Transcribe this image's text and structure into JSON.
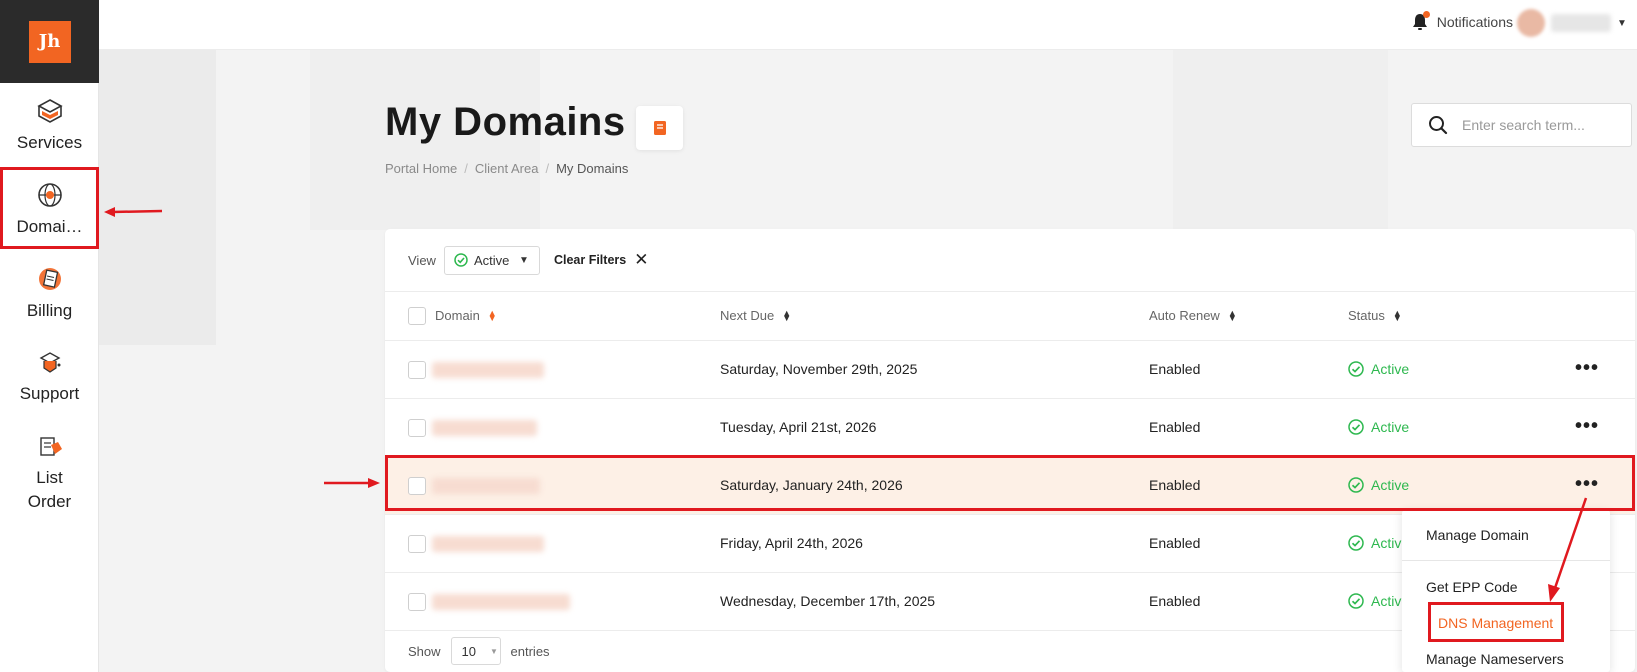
{
  "brand": {
    "logo_text": "Jh",
    "accent": "#f26522"
  },
  "sidebar": {
    "items": [
      {
        "label": "Services",
        "icon": "cube-icon"
      },
      {
        "label": "Domai…",
        "icon": "globe-icon"
      },
      {
        "label": "Billing",
        "icon": "invoice-icon"
      },
      {
        "label": "Support",
        "icon": "support-icon"
      },
      {
        "label": "List Order",
        "icon": "order-list-icon"
      }
    ]
  },
  "topbar": {
    "notifications_label": "Notifications"
  },
  "page": {
    "title": "My Domains",
    "breadcrumb": [
      "Portal Home",
      "Client Area",
      "My Domains"
    ],
    "search_placeholder": "Enter search term..."
  },
  "filters": {
    "view_label": "View",
    "view_value": "Active",
    "clear_label": "Clear Filters"
  },
  "table": {
    "columns": [
      "Domain",
      "Next Due",
      "Auto Renew",
      "Status"
    ],
    "rows": [
      {
        "next_due": "Saturday, November 29th, 2025",
        "auto_renew": "Enabled",
        "status": "Active"
      },
      {
        "next_due": "Tuesday, April 21st, 2026",
        "auto_renew": "Enabled",
        "status": "Active"
      },
      {
        "next_due": "Saturday, January 24th, 2026",
        "auto_renew": "Enabled",
        "status": "Active"
      },
      {
        "next_due": "Friday, April 24th, 2026",
        "auto_renew": "Enabled",
        "status": "Active"
      },
      {
        "next_due": "Wednesday, December 17th, 2025",
        "auto_renew": "Enabled",
        "status": "Active"
      }
    ],
    "status_color": "#2eb84f",
    "highlight_row_bg": "#fdf0e6"
  },
  "footer": {
    "show_label": "Show",
    "length_value": "10",
    "entries_label": "entries"
  },
  "row_menu": {
    "items": [
      "Manage Domain",
      "Get EPP Code",
      "DNS Management",
      "Manage Nameservers"
    ],
    "active_item": "DNS Management"
  },
  "annotation_color": "#e0191f"
}
